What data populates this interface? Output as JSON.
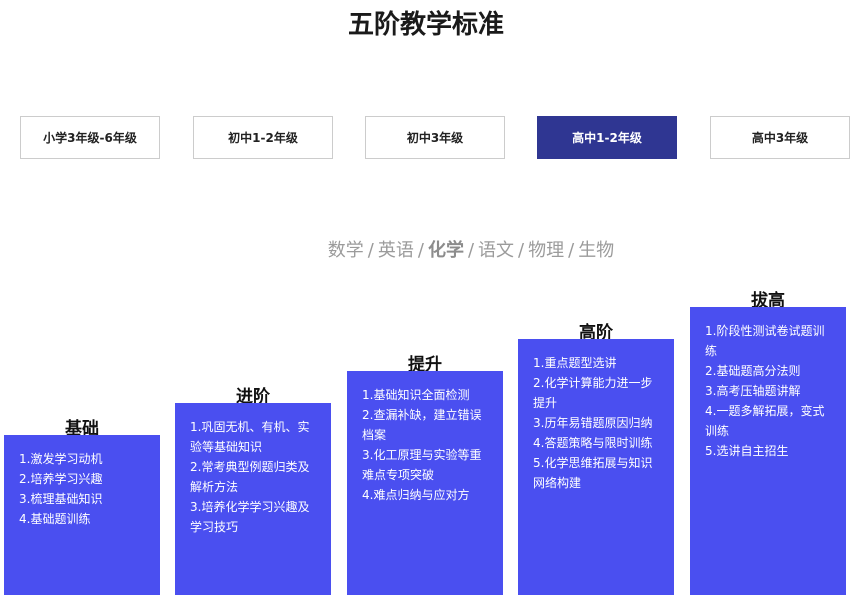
{
  "page": {
    "title": "五阶教学标准"
  },
  "grades": [
    {
      "label": "小学3年级-6年级",
      "active": false
    },
    {
      "label": "初中1-2年级",
      "active": false
    },
    {
      "label": "初中3年级",
      "active": false
    },
    {
      "label": "高中1-2年级",
      "active": true
    },
    {
      "label": "高中3年级",
      "active": false
    }
  ],
  "subjects": {
    "separator": "/",
    "items": [
      {
        "label": "数学",
        "active": false
      },
      {
        "label": "英语",
        "active": false
      },
      {
        "label": "化学",
        "active": true
      },
      {
        "label": "语文",
        "active": false
      },
      {
        "label": "物理",
        "active": false
      },
      {
        "label": "生物",
        "active": false
      }
    ]
  },
  "colors": {
    "accent_tab": "#2f3692",
    "stage_box": "#4a4ff0",
    "subject_text": "#9b9b9b"
  },
  "stages": [
    {
      "label": "基础",
      "items": [
        "1.激发学习动机",
        "2.培养学习兴趣",
        "3.梳理基础知识",
        "4.基础题训练"
      ]
    },
    {
      "label": "进阶",
      "items": [
        "1.巩固无机、有机、实验等基础知识",
        "2.常考典型例题归类及解析方法",
        "3.培养化学学习兴趣及学习技巧"
      ]
    },
    {
      "label": "提升",
      "items": [
        "1.基础知识全面检测",
        "2.查漏补缺，建立错误档案",
        "3.化工原理与实验等重难点专项突破",
        "4.难点归纳与应对方"
      ]
    },
    {
      "label": "高阶",
      "items": [
        "1.重点题型选讲",
        "2.化学计算能力进一步提升",
        "3.历年易错题原因归纳",
        "4.答题策略与限时训练",
        "5.化学思维拓展与知识网络构建"
      ]
    },
    {
      "label": "拔高",
      "items": [
        "1.阶段性测试卷试题训练",
        "2.基础题高分法则",
        "3.高考压轴题讲解",
        "4.一题多解拓展，变式训练",
        "5.选讲自主招生"
      ]
    }
  ]
}
